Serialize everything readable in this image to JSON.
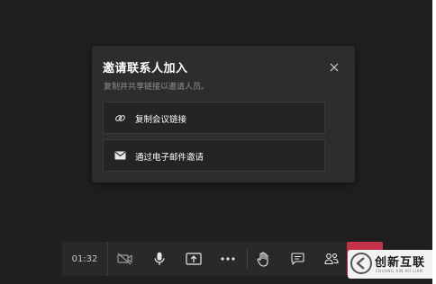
{
  "dialog": {
    "title": "邀请联系人加入",
    "subtitle": "复制并共享链接以邀请人员。",
    "options": [
      {
        "label": "复制会议链接",
        "icon": "link-icon"
      },
      {
        "label": "通过电子邮件邀请",
        "icon": "mail-icon"
      }
    ],
    "close_icon": "close-icon"
  },
  "toolbar": {
    "time": "01:32",
    "buttons": [
      "camera-off-icon",
      "microphone-icon",
      "share-screen-icon",
      "more-options-icon",
      "raise-hand-icon",
      "chat-icon",
      "participants-icon"
    ],
    "hangup_color": "#c4314b"
  },
  "watermark": {
    "text": "创新互联",
    "sub": "CHUANG XIN HU LIAN"
  },
  "colors": {
    "background": "#1f1f1f",
    "dialog": "#2d2d2d",
    "option": "#242424",
    "toolbar": "#292929",
    "accent": "#c4314b"
  }
}
